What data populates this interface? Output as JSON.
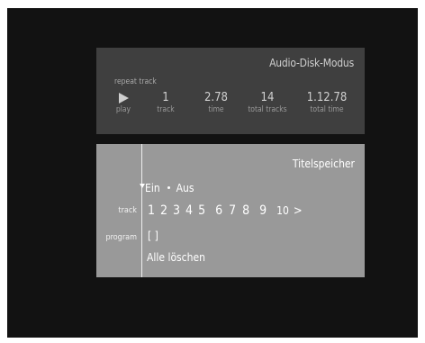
{
  "audio_disk": {
    "title": "Audio-Disk-Modus",
    "repeat_label": "repeat track",
    "stats": [
      {
        "value": "",
        "label": "play",
        "icon": "play-icon"
      },
      {
        "value": "1",
        "label": "track"
      },
      {
        "value": "2.78",
        "label": "time"
      },
      {
        "value": "14",
        "label": "total tracks"
      },
      {
        "value": "1.12.78",
        "label": "total time"
      }
    ]
  },
  "titelspeicher": {
    "title": "Titelspeicher",
    "toggle": {
      "on": "Ein",
      "off": "Aus"
    },
    "track_label": "track",
    "tracks": [
      "1",
      "2",
      "3",
      "4",
      "5",
      "6",
      "7",
      "8",
      "9",
      "10"
    ],
    "next": ">",
    "program_label": "program",
    "program_value": "[ ]",
    "clear_all": "Alle löschen"
  },
  "colors": {
    "background": "#121212",
    "panel_dark": "#3f3f3f",
    "panel_light": "#999999",
    "text_light": "#ffffff"
  }
}
